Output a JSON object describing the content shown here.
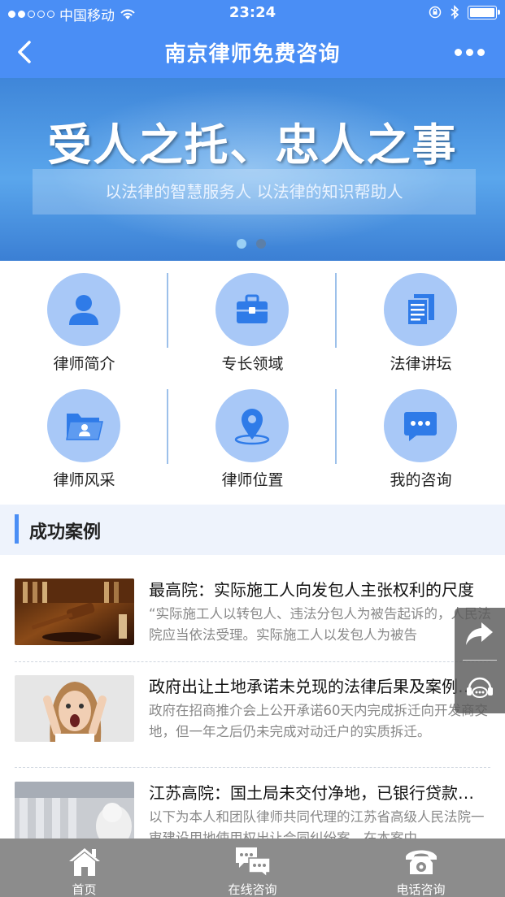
{
  "status_bar": {
    "carrier": "中国移动",
    "time": "23:24"
  },
  "nav": {
    "title": "南京律师免费咨询"
  },
  "banner": {
    "slogan": "受人之托、忠人之事",
    "subtitle": "以法律的智慧服务人 以法律的知识帮助人",
    "slides": 2,
    "active_slide": 1
  },
  "menu": [
    {
      "label": "律师简介",
      "icon": "person-icon"
    },
    {
      "label": "专长领域",
      "icon": "briefcase-icon"
    },
    {
      "label": "法律讲坛",
      "icon": "document-icon"
    },
    {
      "label": "律师风采",
      "icon": "folder-icon"
    },
    {
      "label": "律师位置",
      "icon": "location-pin-icon"
    },
    {
      "label": "我的咨询",
      "icon": "chat-bubble-icon"
    }
  ],
  "section": {
    "title": "成功案例"
  },
  "articles": [
    {
      "title": "最高院：实际施工人向发包人主张权利的尺度",
      "desc": "“实际施工人以转包人、违法分包人为被告起诉的，人民法院应当依法受理。实际施工人以发包人为被告",
      "thumb": "gavel-image"
    },
    {
      "title": "政府出让土地承诺未兑现的法律后果及案例…",
      "desc": "政府在招商推介会上公开承诺60天内完成拆迁向开发商交地，但一年之后仍未完成对动迁户的实质拆迁。",
      "thumb": "surprised-woman-image"
    },
    {
      "title": "江苏高院：国土局未交付净地，已银行贷款…",
      "desc": "以下为本人和团队律师共同代理的江苏省高级人民法院一审建设用地使用权出让合同纠纷案，在本案中",
      "thumb": "court-building-image"
    }
  ],
  "tabbar": [
    {
      "label": "首页",
      "icon": "home-icon"
    },
    {
      "label": "在线咨询",
      "icon": "chat-icon"
    },
    {
      "label": "电话咨询",
      "icon": "telephone-icon"
    }
  ],
  "colors": {
    "primary": "#4a8ef5",
    "icon_circle": "#a8c8f7",
    "tabbar": "#8c8c8c"
  }
}
